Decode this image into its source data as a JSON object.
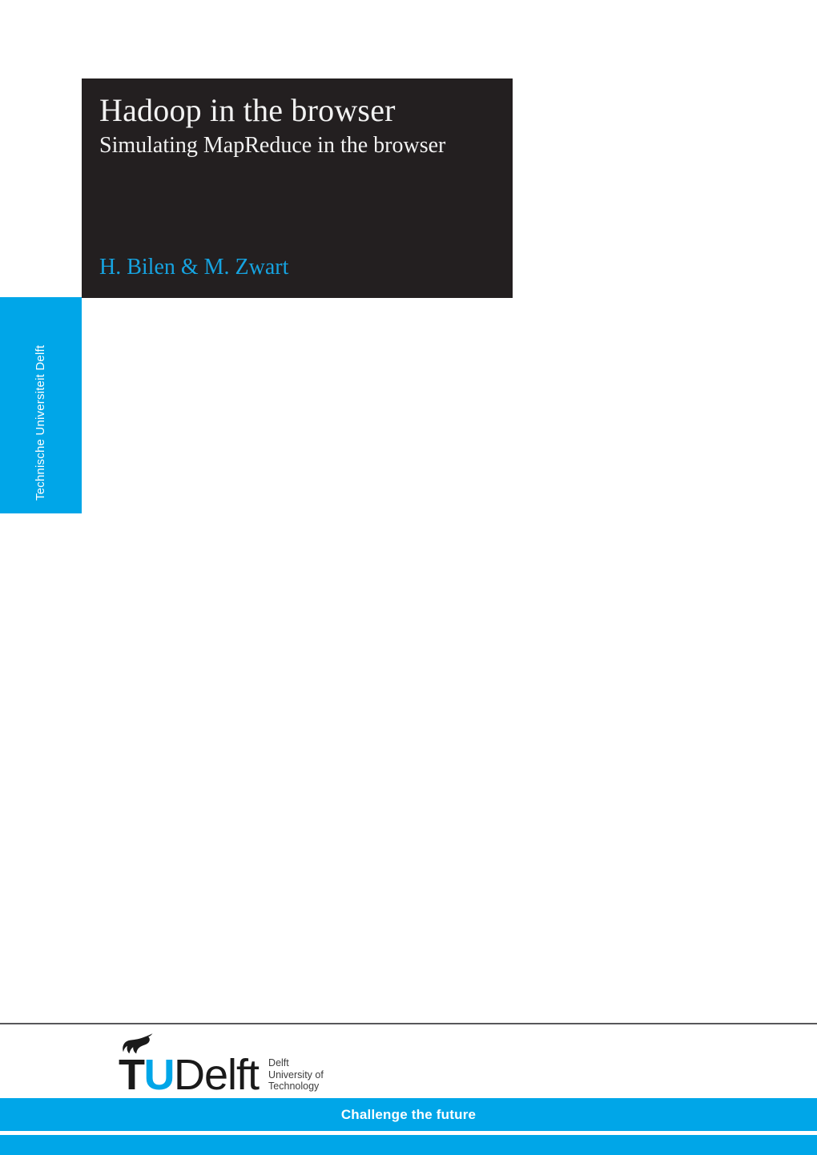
{
  "document": {
    "title": "Hadoop in the browser",
    "subtitle": "Simulating MapReduce in the browser",
    "authors": "H. Bilen & M. Zwart"
  },
  "university_tab": {
    "label": "Technische Universiteit Delft"
  },
  "logo": {
    "flame_icon": "tu-delft-flame-icon",
    "wordmark_t": "T",
    "wordmark_u": "U",
    "wordmark_delft": "Delft",
    "subtitle_line1": "Delft",
    "subtitle_line2": "University of",
    "subtitle_line3": "Technology"
  },
  "footer": {
    "tagline": "Challenge the future"
  },
  "colors": {
    "brand_blue": "#00a6e8",
    "title_block_black": "#231f20",
    "author_blue": "#16a3e0",
    "rule_grey": "#58585a",
    "page_background": "#ffffff"
  }
}
